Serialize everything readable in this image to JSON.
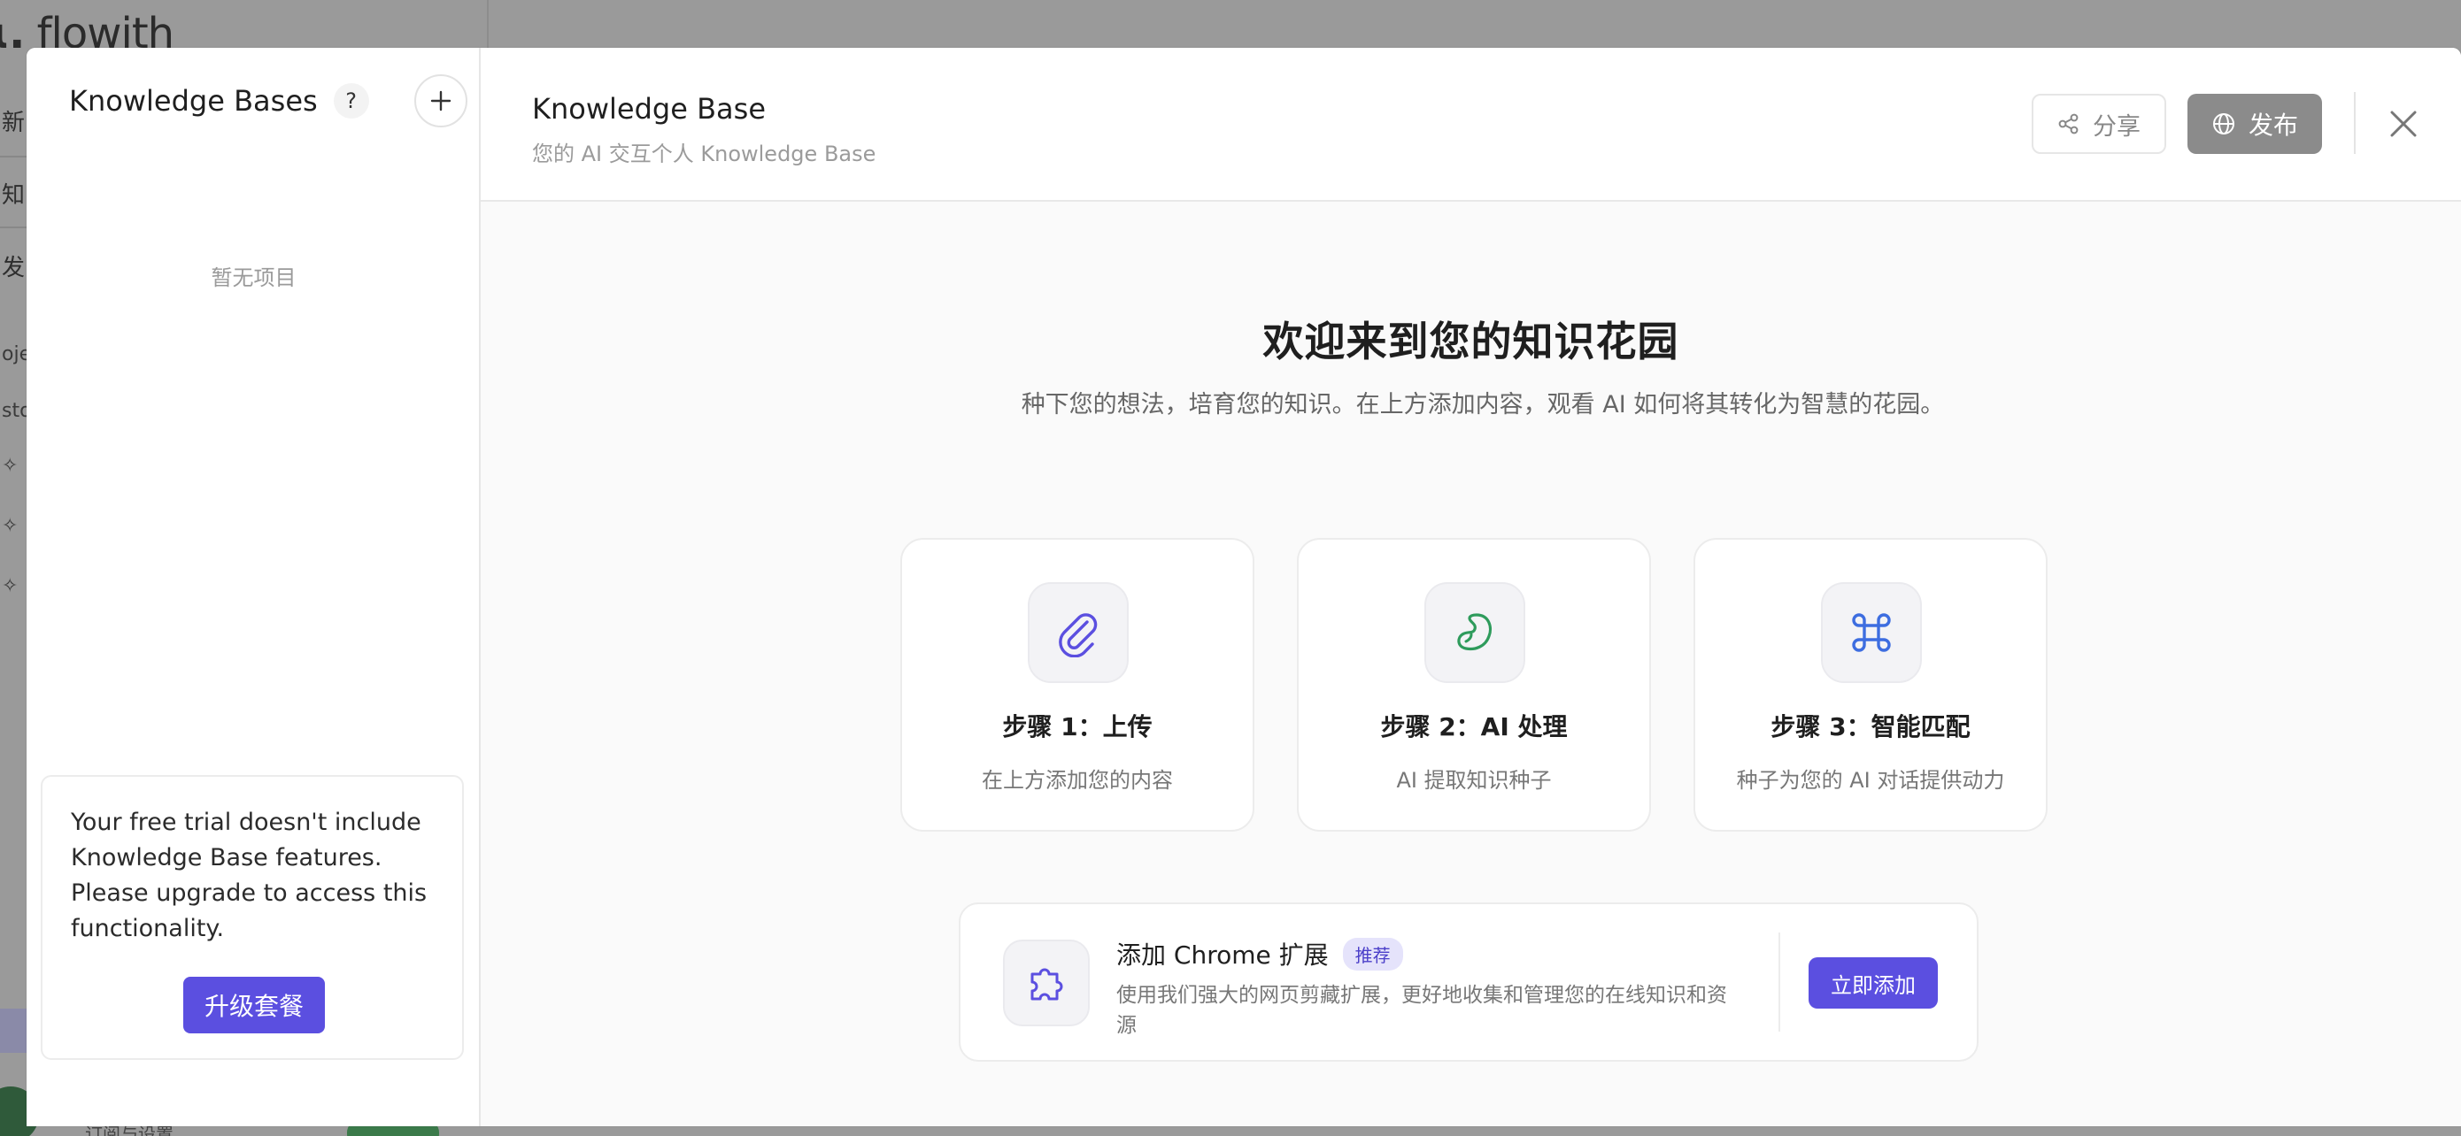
{
  "background": {
    "logo": "flowith",
    "fragments": [
      "新",
      "知",
      "发",
      "oje",
      "sto"
    ],
    "footer": "订阅与设置"
  },
  "sidebar": {
    "title": "Knowledge Bases",
    "help_label": "?",
    "empty_text": "暂无项目",
    "trial_text": "Your free trial doesn't include Knowledge Base features. Please upgrade to access this functionality.",
    "upgrade_label": "升级套餐"
  },
  "header": {
    "title": "Knowledge Base",
    "subtitle": "您的 AI 交互个人 Knowledge Base",
    "share_label": "分享",
    "publish_label": "发布"
  },
  "welcome": {
    "title": "欢迎来到您的知识花园",
    "description": "种下您的想法，培育您的知识。在上方添加内容，观看 AI 如何将其转化为智慧的花园。"
  },
  "steps": [
    {
      "title": "步骤 1：上传",
      "description": "在上方添加您的内容",
      "icon": "paperclip-icon",
      "color": "#5b4fe0"
    },
    {
      "title": "步骤 2：AI 处理",
      "description": "AI 提取知识种子",
      "icon": "seed-icon",
      "color": "#2e9b5c"
    },
    {
      "title": "步骤 3：智能匹配",
      "description": "种子为您的 AI 对话提供动力",
      "icon": "command-icon",
      "color": "#3d6de0"
    }
  ],
  "extension": {
    "title": "添加 Chrome 扩展",
    "badge": "推荐",
    "description": "使用我们强大的网页剪藏扩展，更好地收集和管理您的在线知识和资源",
    "button_label": "立即添加"
  },
  "colors": {
    "accent": "#5b4fe0",
    "publish_disabled": "#8b8b8b"
  }
}
